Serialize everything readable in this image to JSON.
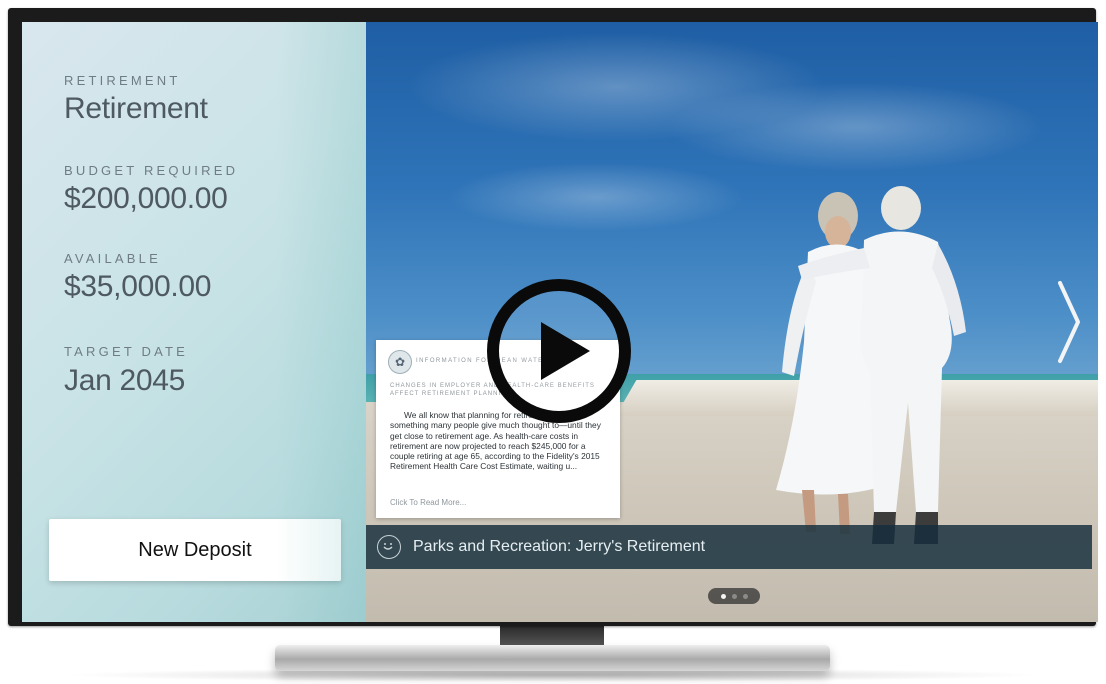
{
  "goal": {
    "category_label": "RETIREMENT",
    "name": "Retirement",
    "budget_label": "BUDGET REQUIRED",
    "budget_value": "$200,000.00",
    "available_label": "AVAILABLE",
    "available_value": "$35,000.00",
    "target_label": "TARGET DATE",
    "target_value": "Jan 2045"
  },
  "actions": {
    "new_deposit_label": "New Deposit"
  },
  "article": {
    "source": "INFORMATION FOR DEAN WATERS",
    "heading": "CHANGES IN EMPLOYER AND HEALTH-CARE BENEFITS AFFECT RETIREMENT PLANNING",
    "body": "We all know that planning for retirement isn't something many people give much thought to—until they get close to retirement age. As health-care costs in retirement are now projected to reach $245,000 for a couple retiring at age 65, according to the Fidelity's 2015 Retirement Health Care Cost Estimate, waiting u...",
    "more_link": "Click To Read More..."
  },
  "media": {
    "caption": "Parks and Recreation: Jerry's Retirement",
    "play_icon": "play-icon",
    "next_icon": "chevron-right-icon",
    "page_count": 3,
    "active_page": 1
  },
  "colors": {
    "panel_text": "#4e5962",
    "label_text": "#6f7c84",
    "caption_bar": "#142d3c",
    "sky": "#2f74b8"
  }
}
